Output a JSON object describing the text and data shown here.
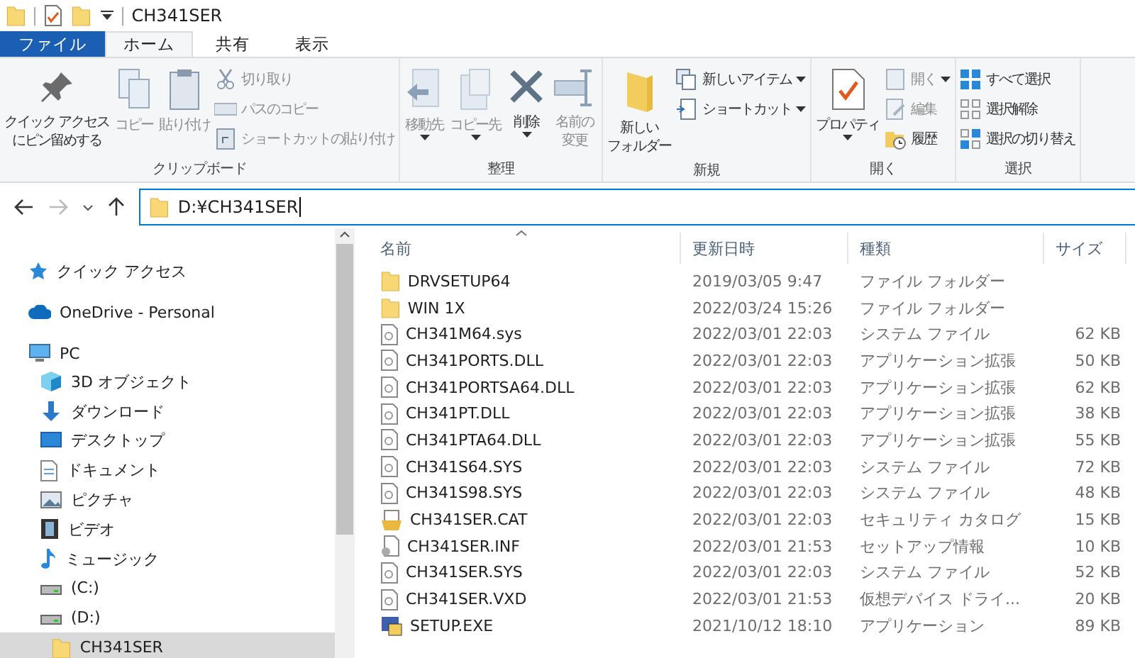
{
  "window": {
    "title": "CH341SER"
  },
  "tabs": [
    {
      "label": "ファイル",
      "kind": "file",
      "selected": false
    },
    {
      "label": "ホーム",
      "kind": "tab",
      "selected": true
    },
    {
      "label": "共有",
      "kind": "tab",
      "selected": false
    },
    {
      "label": "表示",
      "kind": "tab",
      "selected": false
    }
  ],
  "ribbon": {
    "groups": [
      {
        "label": "クリップボード",
        "large": [
          {
            "lines": [
              "クイック アクセス",
              "にピン留めする"
            ],
            "disabled": false,
            "dropdown": false
          },
          {
            "label": "コピー",
            "disabled": true,
            "dropdown": false
          },
          {
            "label": "貼り付け",
            "disabled": true,
            "dropdown": false
          }
        ],
        "small": [
          {
            "label": "切り取り",
            "disabled": true,
            "dropdown": false
          },
          {
            "label": "パスのコピー",
            "disabled": true,
            "dropdown": false
          },
          {
            "label": "ショートカットの貼り付け",
            "disabled": true,
            "dropdown": false
          }
        ]
      },
      {
        "label": "整理",
        "large": [
          {
            "label": "移動先",
            "disabled": true,
            "dropdown": true
          },
          {
            "label": "コピー先",
            "disabled": true,
            "dropdown": true
          },
          {
            "label": "削除",
            "disabled": false,
            "dropdown": true
          },
          {
            "lines": [
              "名前の",
              "変更"
            ],
            "disabled": true,
            "dropdown": false
          }
        ]
      },
      {
        "label": "新規",
        "large": [
          {
            "lines": [
              "新しい",
              "フォルダー"
            ],
            "disabled": false,
            "dropdown": false
          }
        ],
        "small": [
          {
            "label": "新しいアイテム",
            "disabled": false,
            "dropdown": true
          },
          {
            "label": "ショートカット",
            "disabled": false,
            "dropdown": true
          }
        ]
      },
      {
        "label": "開く",
        "large": [
          {
            "label": "プロパティ",
            "disabled": false,
            "dropdown": true
          }
        ],
        "small": [
          {
            "label": "開く",
            "disabled": true,
            "dropdown": true
          },
          {
            "label": "編集",
            "disabled": true,
            "dropdown": false
          },
          {
            "label": "履歴",
            "disabled": false,
            "dropdown": false
          }
        ]
      },
      {
        "label": "選択",
        "small": [
          {
            "label": "すべて選択",
            "disabled": false,
            "dropdown": false
          },
          {
            "label": "選択解除",
            "disabled": false,
            "dropdown": false
          },
          {
            "label": "選択の切り替え",
            "disabled": false,
            "dropdown": false
          }
        ]
      }
    ]
  },
  "address": {
    "path": "D:¥CH341SER",
    "back_disabled": false,
    "forward_disabled": true
  },
  "sidebar": {
    "items": [
      {
        "label": "クイック アクセス",
        "kind": "quick",
        "selected": false
      },
      {
        "label": "OneDrive - Personal",
        "kind": "cloud",
        "selected": false
      },
      {
        "label": "PC",
        "kind": "pc",
        "selected": false,
        "children": [
          {
            "label": "3D オブジェクト",
            "kind": "cube",
            "selected": false
          },
          {
            "label": "ダウンロード",
            "kind": "download",
            "selected": false
          },
          {
            "label": "デスクトップ",
            "kind": "desktop",
            "selected": false
          },
          {
            "label": "ドキュメント",
            "kind": "document",
            "selected": false
          },
          {
            "label": "ピクチャ",
            "kind": "pictures",
            "selected": false
          },
          {
            "label": "ビデオ",
            "kind": "video",
            "selected": false
          },
          {
            "label": "ミュージック",
            "kind": "music",
            "selected": false
          },
          {
            "label": "(C:)",
            "kind": "drive",
            "selected": false
          },
          {
            "label": "(D:)",
            "kind": "drive",
            "selected": false,
            "children": [
              {
                "label": "CH341SER",
                "kind": "folder",
                "selected": true
              }
            ]
          }
        ]
      }
    ]
  },
  "table": {
    "columns": [
      "名前",
      "更新日時",
      "種類",
      "サイズ"
    ],
    "rows": [
      {
        "name": "DRVSETUP64",
        "date": "2019/03/05 9:47",
        "type": "ファイル フォルダー",
        "kind": "folder"
      },
      {
        "name": "WIN 1X",
        "date": "2022/03/24 15:26",
        "type": "ファイル フォルダー",
        "kind": "folder"
      },
      {
        "name": "CH341M64.sys",
        "date": "2022/03/01 22:03",
        "type": "システム ファイル",
        "size": "62 KB",
        "kind": "sys"
      },
      {
        "name": "CH341PORTS.DLL",
        "date": "2022/03/01 22:03",
        "type": "アプリケーション拡張",
        "size": "50 KB",
        "kind": "sys"
      },
      {
        "name": "CH341PORTSA64.DLL",
        "date": "2022/03/01 22:03",
        "type": "アプリケーション拡張",
        "size": "62 KB",
        "kind": "sys"
      },
      {
        "name": "CH341PT.DLL",
        "date": "2022/03/01 22:03",
        "type": "アプリケーション拡張",
        "size": "38 KB",
        "kind": "sys"
      },
      {
        "name": "CH341PTA64.DLL",
        "date": "2022/03/01 22:03",
        "type": "アプリケーション拡張",
        "size": "55 KB",
        "kind": "sys"
      },
      {
        "name": "CH341S64.SYS",
        "date": "2022/03/01 22:03",
        "type": "システム ファイル",
        "size": "72 KB",
        "kind": "sys"
      },
      {
        "name": "CH341S98.SYS",
        "date": "2022/03/01 22:03",
        "type": "システム ファイル",
        "size": "48 KB",
        "kind": "sys"
      },
      {
        "name": "CH341SER.CAT",
        "date": "2022/03/01 22:03",
        "type": "セキュリティ カタログ",
        "size": "15 KB",
        "kind": "cat"
      },
      {
        "name": "CH341SER.INF",
        "date": "2022/03/01 21:53",
        "type": "セットアップ情報",
        "size": "10 KB",
        "kind": "inf"
      },
      {
        "name": "CH341SER.SYS",
        "date": "2022/03/01 22:03",
        "type": "システム ファイル",
        "size": "52 KB",
        "kind": "sys"
      },
      {
        "name": "CH341SER.VXD",
        "date": "2022/03/01 21:53",
        "type": "仮想デバイス ドライ...",
        "size": "20 KB",
        "kind": "sys"
      },
      {
        "name": "SETUP.EXE",
        "date": "2021/10/12 18:10",
        "type": "アプリケーション",
        "size": "89 KB",
        "kind": "exe"
      }
    ]
  }
}
